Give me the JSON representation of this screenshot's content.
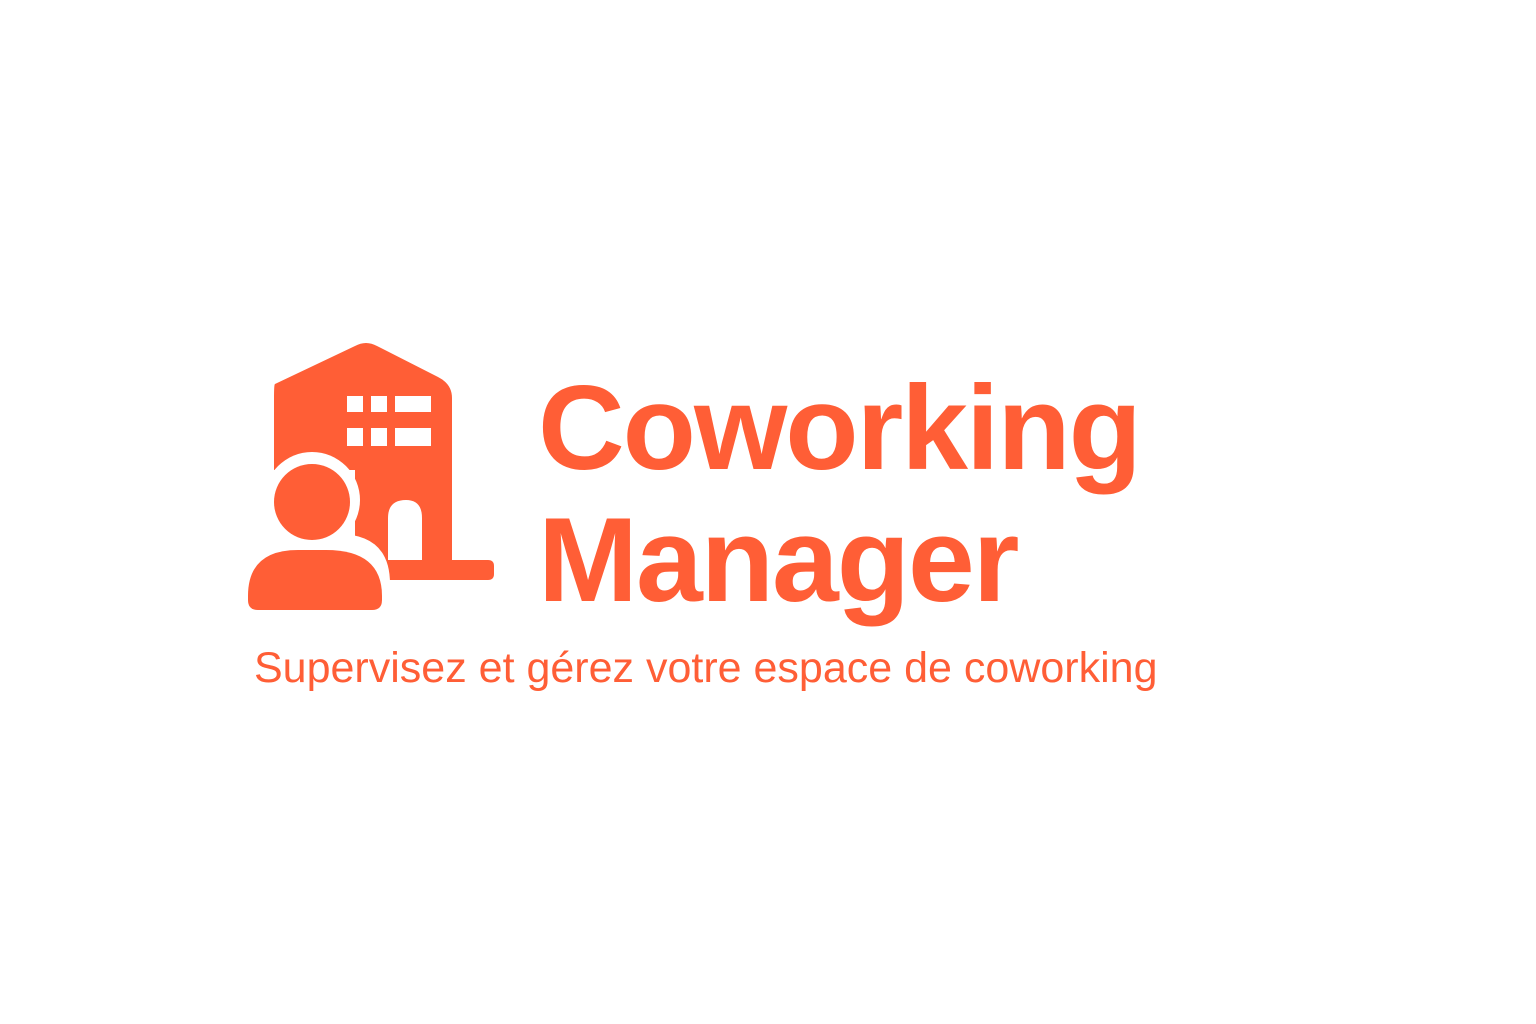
{
  "brand": {
    "name_line1": "Coworking",
    "name_line2": "Manager",
    "tagline": "Supervisez et gérez votre espace de coworking",
    "accent_color": "#FF5E36",
    "background_color": "#FFFFFF",
    "icon": "building-with-person-icon"
  }
}
